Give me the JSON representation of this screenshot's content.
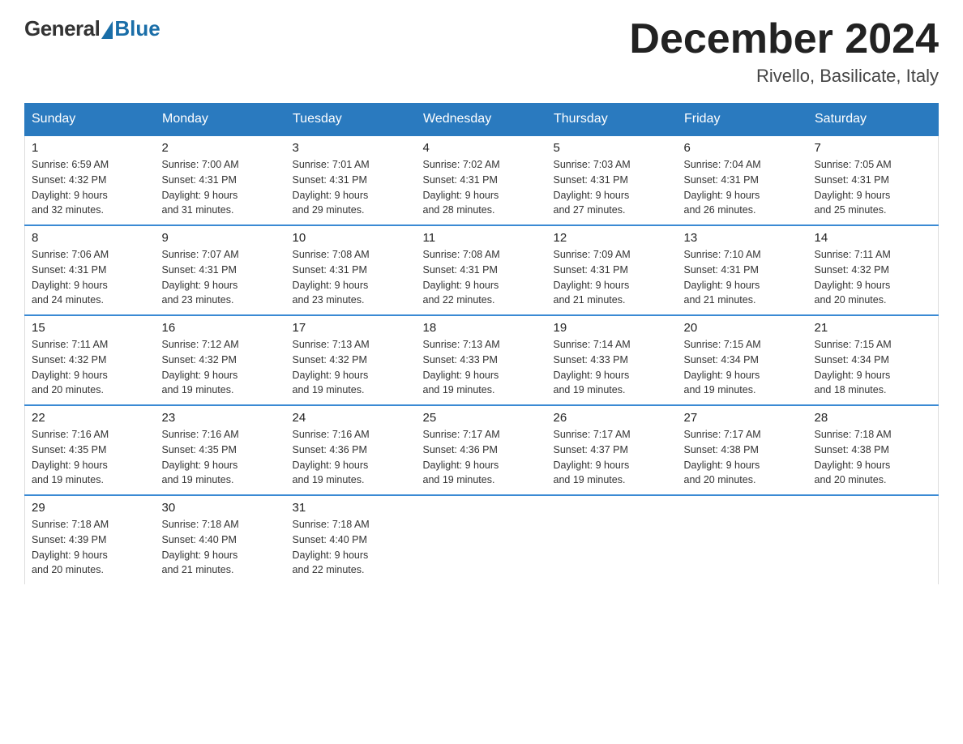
{
  "logo": {
    "general": "General",
    "blue": "Blue",
    "subtitle": ""
  },
  "header": {
    "month_title": "December 2024",
    "location": "Rivello, Basilicate, Italy"
  },
  "weekdays": [
    "Sunday",
    "Monday",
    "Tuesday",
    "Wednesday",
    "Thursday",
    "Friday",
    "Saturday"
  ],
  "weeks": [
    [
      {
        "day": "1",
        "sunrise": "6:59 AM",
        "sunset": "4:32 PM",
        "daylight": "9 hours and 32 minutes."
      },
      {
        "day": "2",
        "sunrise": "7:00 AM",
        "sunset": "4:31 PM",
        "daylight": "9 hours and 31 minutes."
      },
      {
        "day": "3",
        "sunrise": "7:01 AM",
        "sunset": "4:31 PM",
        "daylight": "9 hours and 29 minutes."
      },
      {
        "day": "4",
        "sunrise": "7:02 AM",
        "sunset": "4:31 PM",
        "daylight": "9 hours and 28 minutes."
      },
      {
        "day": "5",
        "sunrise": "7:03 AM",
        "sunset": "4:31 PM",
        "daylight": "9 hours and 27 minutes."
      },
      {
        "day": "6",
        "sunrise": "7:04 AM",
        "sunset": "4:31 PM",
        "daylight": "9 hours and 26 minutes."
      },
      {
        "day": "7",
        "sunrise": "7:05 AM",
        "sunset": "4:31 PM",
        "daylight": "9 hours and 25 minutes."
      }
    ],
    [
      {
        "day": "8",
        "sunrise": "7:06 AM",
        "sunset": "4:31 PM",
        "daylight": "9 hours and 24 minutes."
      },
      {
        "day": "9",
        "sunrise": "7:07 AM",
        "sunset": "4:31 PM",
        "daylight": "9 hours and 23 minutes."
      },
      {
        "day": "10",
        "sunrise": "7:08 AM",
        "sunset": "4:31 PM",
        "daylight": "9 hours and 23 minutes."
      },
      {
        "day": "11",
        "sunrise": "7:08 AM",
        "sunset": "4:31 PM",
        "daylight": "9 hours and 22 minutes."
      },
      {
        "day": "12",
        "sunrise": "7:09 AM",
        "sunset": "4:31 PM",
        "daylight": "9 hours and 21 minutes."
      },
      {
        "day": "13",
        "sunrise": "7:10 AM",
        "sunset": "4:31 PM",
        "daylight": "9 hours and 21 minutes."
      },
      {
        "day": "14",
        "sunrise": "7:11 AM",
        "sunset": "4:32 PM",
        "daylight": "9 hours and 20 minutes."
      }
    ],
    [
      {
        "day": "15",
        "sunrise": "7:11 AM",
        "sunset": "4:32 PM",
        "daylight": "9 hours and 20 minutes."
      },
      {
        "day": "16",
        "sunrise": "7:12 AM",
        "sunset": "4:32 PM",
        "daylight": "9 hours and 19 minutes."
      },
      {
        "day": "17",
        "sunrise": "7:13 AM",
        "sunset": "4:32 PM",
        "daylight": "9 hours and 19 minutes."
      },
      {
        "day": "18",
        "sunrise": "7:13 AM",
        "sunset": "4:33 PM",
        "daylight": "9 hours and 19 minutes."
      },
      {
        "day": "19",
        "sunrise": "7:14 AM",
        "sunset": "4:33 PM",
        "daylight": "9 hours and 19 minutes."
      },
      {
        "day": "20",
        "sunrise": "7:15 AM",
        "sunset": "4:34 PM",
        "daylight": "9 hours and 19 minutes."
      },
      {
        "day": "21",
        "sunrise": "7:15 AM",
        "sunset": "4:34 PM",
        "daylight": "9 hours and 18 minutes."
      }
    ],
    [
      {
        "day": "22",
        "sunrise": "7:16 AM",
        "sunset": "4:35 PM",
        "daylight": "9 hours and 19 minutes."
      },
      {
        "day": "23",
        "sunrise": "7:16 AM",
        "sunset": "4:35 PM",
        "daylight": "9 hours and 19 minutes."
      },
      {
        "day": "24",
        "sunrise": "7:16 AM",
        "sunset": "4:36 PM",
        "daylight": "9 hours and 19 minutes."
      },
      {
        "day": "25",
        "sunrise": "7:17 AM",
        "sunset": "4:36 PM",
        "daylight": "9 hours and 19 minutes."
      },
      {
        "day": "26",
        "sunrise": "7:17 AM",
        "sunset": "4:37 PM",
        "daylight": "9 hours and 19 minutes."
      },
      {
        "day": "27",
        "sunrise": "7:17 AM",
        "sunset": "4:38 PM",
        "daylight": "9 hours and 20 minutes."
      },
      {
        "day": "28",
        "sunrise": "7:18 AM",
        "sunset": "4:38 PM",
        "daylight": "9 hours and 20 minutes."
      }
    ],
    [
      {
        "day": "29",
        "sunrise": "7:18 AM",
        "sunset": "4:39 PM",
        "daylight": "9 hours and 20 minutes."
      },
      {
        "day": "30",
        "sunrise": "7:18 AM",
        "sunset": "4:40 PM",
        "daylight": "9 hours and 21 minutes."
      },
      {
        "day": "31",
        "sunrise": "7:18 AM",
        "sunset": "4:40 PM",
        "daylight": "9 hours and 22 minutes."
      },
      null,
      null,
      null,
      null
    ]
  ],
  "labels": {
    "sunrise": "Sunrise:",
    "sunset": "Sunset:",
    "daylight": "Daylight:"
  }
}
